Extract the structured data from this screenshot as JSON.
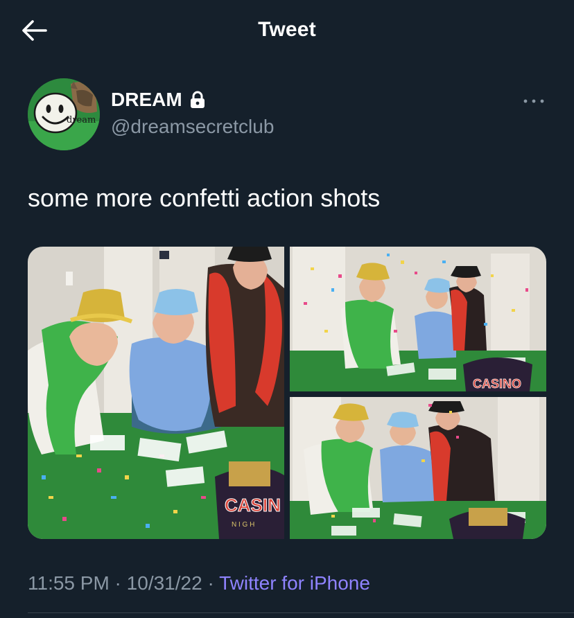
{
  "header": {
    "title": "Tweet",
    "back_icon": "arrow-left-icon"
  },
  "author": {
    "display_name": "DREAM",
    "handle": "@dreamsecretclub",
    "avatar_text": "dream",
    "protected_icon": "lock-icon",
    "more_icon": "more-horizontal-icon"
  },
  "tweet": {
    "text": "some more confetti action shots",
    "photos": [
      {
        "name": "Photo 1"
      },
      {
        "name": "Photo 2",
        "sign": "CASINO"
      },
      {
        "name": "Photo 3"
      }
    ],
    "photo1_sign": "CASIN",
    "photo1_sign_sub": "N I G H"
  },
  "meta": {
    "time": "11:55 PM",
    "sep1": " · ",
    "date": "10/31/22",
    "sep2": " · ",
    "source": "Twitter for iPhone"
  },
  "colors": {
    "background": "#15202b",
    "text": "#ffffff",
    "secondary": "#8b98a5",
    "link": "#8f83ff",
    "divider": "#38444d"
  }
}
